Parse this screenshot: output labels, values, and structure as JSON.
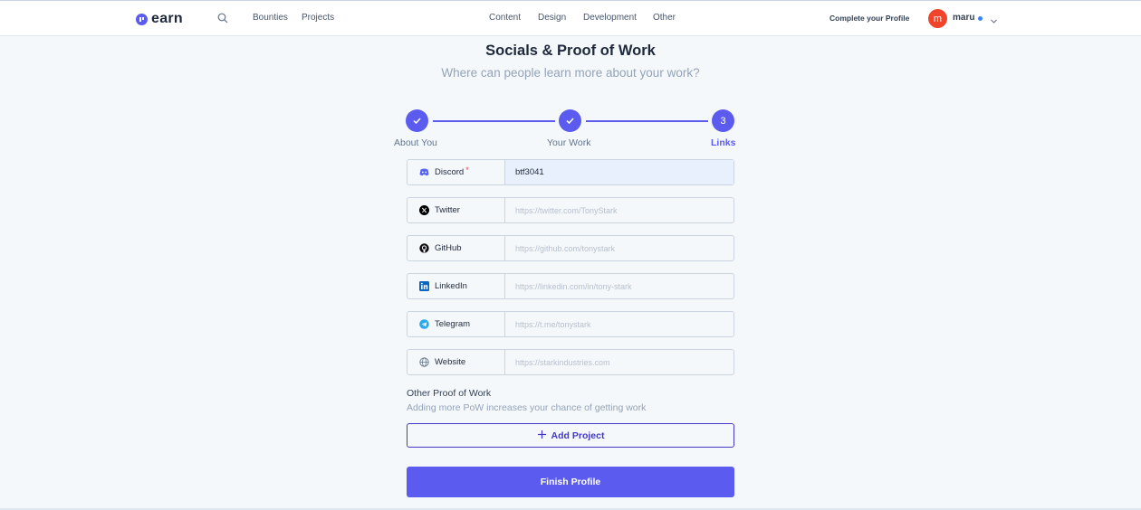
{
  "nav": {
    "logo_text": "earn",
    "links": {
      "bounties": "Bounties",
      "projects": "Projects",
      "content": "Content",
      "design": "Design",
      "development": "Development",
      "other": "Other"
    },
    "complete_profile": "Complete your Profile",
    "avatar_initial": "m",
    "username": "maru"
  },
  "header": {
    "title": "Socials & Proof of Work",
    "subtitle": "Where can people learn more about your work?"
  },
  "steps": [
    {
      "label": "About You",
      "state": "done"
    },
    {
      "label": "Your Work",
      "state": "done"
    },
    {
      "label": "Links",
      "number": "3",
      "state": "active"
    }
  ],
  "fields": {
    "discord": {
      "label": "Discord",
      "required_mark": "*",
      "value": "btf3041",
      "icon": "discord-icon"
    },
    "twitter": {
      "label": "Twitter",
      "placeholder": "https://twitter.com/TonyStark",
      "icon": "x-icon"
    },
    "github": {
      "label": "GitHub",
      "placeholder": "https://github.com/tonystark",
      "icon": "github-icon"
    },
    "linkedin": {
      "label": "LinkedIn",
      "placeholder": "https://linkedin.com/in/tony-stark",
      "icon": "linkedin-icon"
    },
    "telegram": {
      "label": "Telegram",
      "placeholder": "https://t.me/tonystark",
      "icon": "telegram-icon"
    },
    "website": {
      "label": "Website",
      "placeholder": "https://starkindustries.com",
      "icon": "globe-icon"
    }
  },
  "pow": {
    "title": "Other Proof of Work",
    "subtitle": "Adding more PoW increases your chance of getting work",
    "add_button": "Add Project"
  },
  "finish_button": "Finish Profile",
  "colors": {
    "accent": "#5b5bf0",
    "avatar": "#f1442a",
    "filled_input": "#e8f0fe"
  }
}
